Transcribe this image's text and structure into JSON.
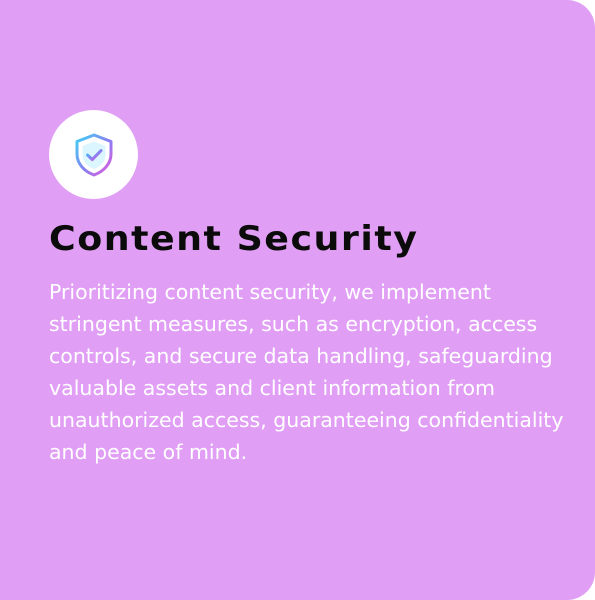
{
  "card": {
    "background_color": "#e19ef5",
    "icon": "shield-check-icon",
    "title": "Content Security",
    "description": "Prioritizing content security, we implement stringent measures, such as encryption, access controls, and secure data handling, safeguarding valuable assets and client information from unauthorized access, guaranteeing confidentiality and peace of mind."
  }
}
